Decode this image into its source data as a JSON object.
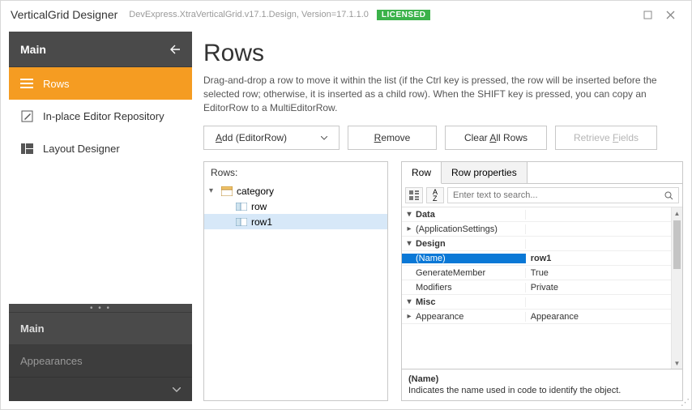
{
  "titlebar": {
    "app": "VerticalGrid Designer",
    "version": "DevExpress.XtraVerticalGrid.v17.1.Design, Version=17.1.1.0",
    "license": "LICENSED"
  },
  "sidebar": {
    "head": "Main",
    "items": [
      {
        "label": "Rows"
      },
      {
        "label": "In-place Editor Repository"
      },
      {
        "label": "Layout Designer"
      }
    ],
    "tabs": [
      {
        "label": "Main"
      },
      {
        "label": "Appearances"
      }
    ]
  },
  "page": {
    "title": "Rows",
    "description": "Drag-and-drop a row to move it within the list (if the Ctrl key is pressed, the row will be inserted before the selected row; otherwise, it is inserted as a child row). When the SHIFT key is pressed, you can copy an EditorRow to a MultiEditorRow."
  },
  "toolbar": {
    "add_prefix": "A",
    "add_rest": "dd (EditorRow)",
    "remove_prefix": "R",
    "remove_rest": "emove",
    "clear_prefix": "Clear ",
    "clear_u": "A",
    "clear_rest": "ll Rows",
    "retrieve_prefix": "Retrieve ",
    "retrieve_u": "F",
    "retrieve_rest": "ields"
  },
  "tree": {
    "header": "Rows:",
    "nodes": {
      "category": "category",
      "row": "row",
      "row1": "row1"
    }
  },
  "props": {
    "tabs": {
      "row": "Row",
      "rowprops": "Row properties"
    },
    "search_placeholder": "Enter text to search...",
    "cats": {
      "data": "Data",
      "design": "Design",
      "misc": "Misc"
    },
    "rows": {
      "appsettings": "(ApplicationSettings)",
      "name_k": "(Name)",
      "name_v": "row1",
      "gen_k": "GenerateMember",
      "gen_v": "True",
      "mod_k": "Modifiers",
      "mod_v": "Private",
      "appe_k": "Appearance",
      "appe_v": "Appearance"
    },
    "desc": {
      "title": "(Name)",
      "body": "Indicates the name used in code to identify the object."
    }
  }
}
